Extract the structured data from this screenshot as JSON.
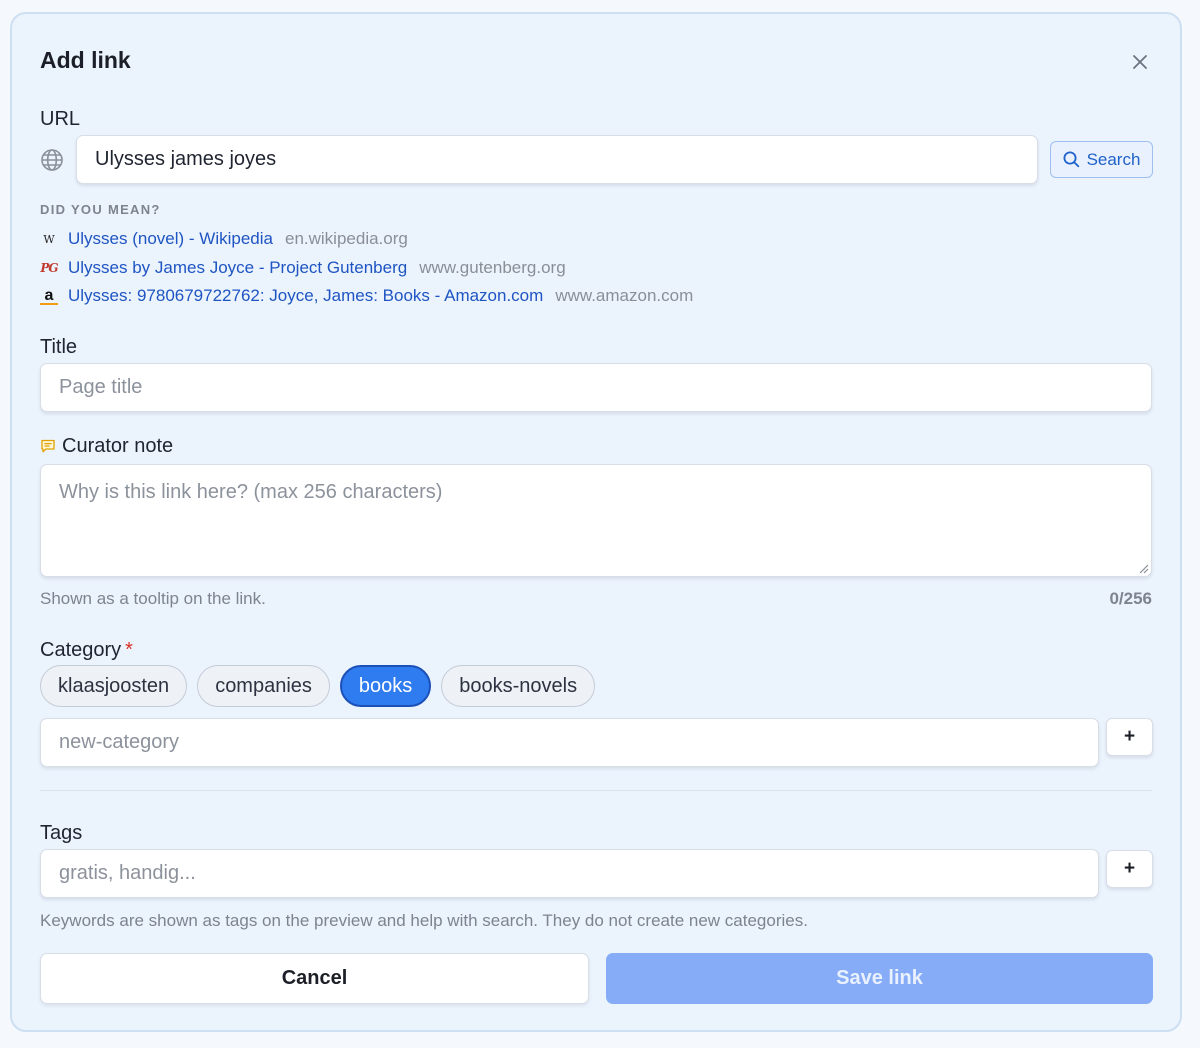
{
  "dialog": {
    "title": "Add link",
    "close_icon": "close-icon"
  },
  "url": {
    "label": "URL",
    "value": "Ulysses james joyes",
    "icon": "globe-icon",
    "search_label": "Search"
  },
  "suggestions": {
    "heading": "DID YOU MEAN?",
    "items": [
      {
        "title": "Ulysses (novel) - Wikipedia",
        "domain": "en.wikipedia.org",
        "icon": "wikipedia-icon",
        "glyph": "W"
      },
      {
        "title": "Ulysses by James Joyce - Project Gutenberg",
        "domain": "www.gutenberg.org",
        "icon": "gutenberg-icon",
        "glyph": "PG"
      },
      {
        "title": "Ulysses: 9780679722762: Joyce, James: Books - Amazon.com",
        "domain": "www.amazon.com",
        "icon": "amazon-icon",
        "glyph": "a"
      }
    ]
  },
  "title_field": {
    "label": "Title",
    "placeholder": "Page title",
    "value": ""
  },
  "curator_note": {
    "label": "Curator note",
    "placeholder": "Why is this link here? (max 256 characters)",
    "hint": "Shown as a tooltip on the link.",
    "counter": "0/256"
  },
  "category": {
    "label": "Category",
    "required_mark": "*",
    "chips": [
      {
        "label": "klaasjoosten",
        "selected": false
      },
      {
        "label": "companies",
        "selected": false
      },
      {
        "label": "books",
        "selected": true
      },
      {
        "label": "books-novels",
        "selected": false
      }
    ],
    "new_placeholder": "new-category",
    "add_label": "+"
  },
  "tags": {
    "label": "Tags",
    "placeholder": "gratis, handig...",
    "add_label": "+",
    "hint": "Keywords are shown as tags on the preview and help with search. They do not create new categories."
  },
  "actions": {
    "cancel_label": "Cancel",
    "save_label": "Save link"
  },
  "colors": {
    "accent": "#2f7bf0",
    "link": "#1f55c2",
    "save_disabled": "#86abf7"
  }
}
